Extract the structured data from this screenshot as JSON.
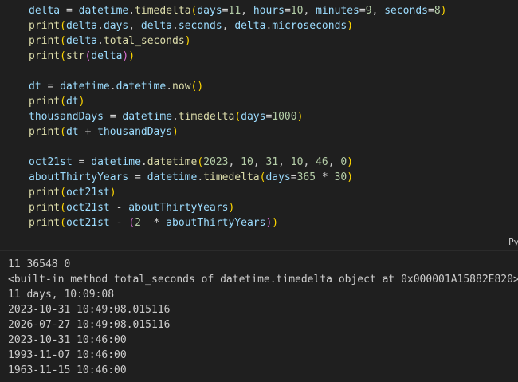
{
  "colors": {
    "default": "#cccccc",
    "variable": "#9cdcfe",
    "function": "#dcdcaa",
    "number": "#b5cea8",
    "bracket1": "#ffd700",
    "bracket2": "#da70d6",
    "operator": "#d4d4d4"
  },
  "cell": {
    "language_badge": "Py",
    "lines": [
      [
        [
          "delta",
          "variable"
        ],
        [
          " = ",
          "operator"
        ],
        [
          "datetime",
          "variable"
        ],
        [
          ".",
          "default"
        ],
        [
          "timedelta",
          "function"
        ],
        [
          "(",
          "bracket1"
        ],
        [
          "days",
          "variable"
        ],
        [
          "=",
          "operator"
        ],
        [
          "11",
          "number"
        ],
        [
          ", ",
          "default"
        ],
        [
          "hours",
          "variable"
        ],
        [
          "=",
          "operator"
        ],
        [
          "10",
          "number"
        ],
        [
          ", ",
          "default"
        ],
        [
          "minutes",
          "variable"
        ],
        [
          "=",
          "operator"
        ],
        [
          "9",
          "number"
        ],
        [
          ", ",
          "default"
        ],
        [
          "seconds",
          "variable"
        ],
        [
          "=",
          "operator"
        ],
        [
          "8",
          "number"
        ],
        [
          ")",
          "bracket1"
        ]
      ],
      [
        [
          "print",
          "function"
        ],
        [
          "(",
          "bracket1"
        ],
        [
          "delta",
          "variable"
        ],
        [
          ".",
          "default"
        ],
        [
          "days",
          "variable"
        ],
        [
          ", ",
          "default"
        ],
        [
          "delta",
          "variable"
        ],
        [
          ".",
          "default"
        ],
        [
          "seconds",
          "variable"
        ],
        [
          ", ",
          "default"
        ],
        [
          "delta",
          "variable"
        ],
        [
          ".",
          "default"
        ],
        [
          "microseconds",
          "variable"
        ],
        [
          ")",
          "bracket1"
        ]
      ],
      [
        [
          "print",
          "function"
        ],
        [
          "(",
          "bracket1"
        ],
        [
          "delta",
          "variable"
        ],
        [
          ".",
          "default"
        ],
        [
          "total_seconds",
          "function"
        ],
        [
          ")",
          "bracket1"
        ]
      ],
      [
        [
          "print",
          "function"
        ],
        [
          "(",
          "bracket1"
        ],
        [
          "str",
          "function"
        ],
        [
          "(",
          "bracket2"
        ],
        [
          "delta",
          "variable"
        ],
        [
          ")",
          "bracket2"
        ],
        [
          ")",
          "bracket1"
        ]
      ],
      [],
      [
        [
          "dt",
          "variable"
        ],
        [
          " = ",
          "operator"
        ],
        [
          "datetime",
          "variable"
        ],
        [
          ".",
          "default"
        ],
        [
          "datetime",
          "variable"
        ],
        [
          ".",
          "default"
        ],
        [
          "now",
          "function"
        ],
        [
          "(",
          "bracket1"
        ],
        [
          ")",
          "bracket1"
        ]
      ],
      [
        [
          "print",
          "function"
        ],
        [
          "(",
          "bracket1"
        ],
        [
          "dt",
          "variable"
        ],
        [
          ")",
          "bracket1"
        ]
      ],
      [
        [
          "thousandDays",
          "variable"
        ],
        [
          " = ",
          "operator"
        ],
        [
          "datetime",
          "variable"
        ],
        [
          ".",
          "default"
        ],
        [
          "timedelta",
          "function"
        ],
        [
          "(",
          "bracket1"
        ],
        [
          "days",
          "variable"
        ],
        [
          "=",
          "operator"
        ],
        [
          "1000",
          "number"
        ],
        [
          ")",
          "bracket1"
        ]
      ],
      [
        [
          "print",
          "function"
        ],
        [
          "(",
          "bracket1"
        ],
        [
          "dt",
          "variable"
        ],
        [
          " + ",
          "operator"
        ],
        [
          "thousandDays",
          "variable"
        ],
        [
          ")",
          "bracket1"
        ]
      ],
      [],
      [
        [
          "oct21st",
          "variable"
        ],
        [
          " = ",
          "operator"
        ],
        [
          "datetime",
          "variable"
        ],
        [
          ".",
          "default"
        ],
        [
          "datetime",
          "function"
        ],
        [
          "(",
          "bracket1"
        ],
        [
          "2023",
          "number"
        ],
        [
          ", ",
          "default"
        ],
        [
          "10",
          "number"
        ],
        [
          ", ",
          "default"
        ],
        [
          "31",
          "number"
        ],
        [
          ", ",
          "default"
        ],
        [
          "10",
          "number"
        ],
        [
          ", ",
          "default"
        ],
        [
          "46",
          "number"
        ],
        [
          ", ",
          "default"
        ],
        [
          "0",
          "number"
        ],
        [
          ")",
          "bracket1"
        ]
      ],
      [
        [
          "aboutThirtyYears",
          "variable"
        ],
        [
          " = ",
          "operator"
        ],
        [
          "datetime",
          "variable"
        ],
        [
          ".",
          "default"
        ],
        [
          "timedelta",
          "function"
        ],
        [
          "(",
          "bracket1"
        ],
        [
          "days",
          "variable"
        ],
        [
          "=",
          "operator"
        ],
        [
          "365",
          "number"
        ],
        [
          " * ",
          "operator"
        ],
        [
          "30",
          "number"
        ],
        [
          ")",
          "bracket1"
        ]
      ],
      [
        [
          "print",
          "function"
        ],
        [
          "(",
          "bracket1"
        ],
        [
          "oct21st",
          "variable"
        ],
        [
          ")",
          "bracket1"
        ]
      ],
      [
        [
          "print",
          "function"
        ],
        [
          "(",
          "bracket1"
        ],
        [
          "oct21st",
          "variable"
        ],
        [
          " - ",
          "operator"
        ],
        [
          "aboutThirtyYears",
          "variable"
        ],
        [
          ")",
          "bracket1"
        ]
      ],
      [
        [
          "print",
          "function"
        ],
        [
          "(",
          "bracket1"
        ],
        [
          "oct21st",
          "variable"
        ],
        [
          " - ",
          "operator"
        ],
        [
          "(",
          "bracket2"
        ],
        [
          "2",
          "number"
        ],
        [
          "  * ",
          "operator"
        ],
        [
          "aboutThirtyYears",
          "variable"
        ],
        [
          ")",
          "bracket2"
        ],
        [
          ")",
          "bracket1"
        ]
      ]
    ]
  },
  "output": {
    "lines": [
      "11 36548 0",
      "<built-in method total_seconds of datetime.timedelta object at 0x000001A15882E820>",
      "11 days, 10:09:08",
      "2023-10-31 10:49:08.015116",
      "2026-07-27 10:49:08.015116",
      "2023-10-31 10:46:00",
      "1993-11-07 10:46:00",
      "1963-11-15 10:46:00"
    ]
  }
}
